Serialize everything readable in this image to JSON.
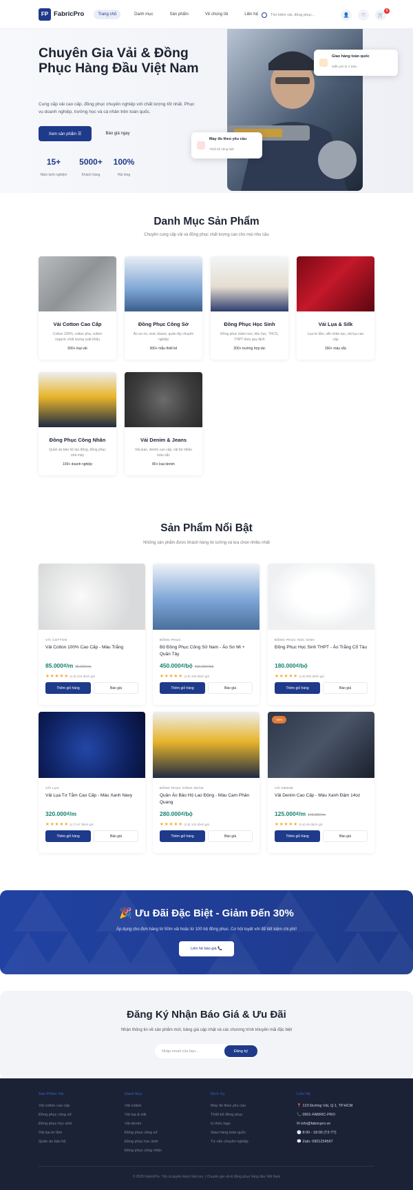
{
  "header": {
    "logo_mark": "FP",
    "logo_text": "FabricPro",
    "nav": [
      "Trang chủ",
      "Danh mục",
      "Sản phẩm",
      "Về chúng tôi",
      "Liên hệ"
    ],
    "search_placeholder": "Tìm kiếm vải, đồng phục...",
    "cart_count": "4"
  },
  "hero": {
    "title": "Chuyên Gia Vải & Đồng Phục Hàng Đầu Việt Nam",
    "desc": "Cung cấp vải cao cấp, đồng phục chuyên nghiệp với chất lượng tốt nhất. Phục vụ doanh nghiệp, trường học và cá nhân trên toàn quốc.",
    "cta_primary": "Xem sản phẩm ☰",
    "cta_secondary": "Báo giá ngay",
    "stats": [
      {
        "value": "15+",
        "label": "Năm kinh nghiệm"
      },
      {
        "value": "5000+",
        "label": "Khách hàng"
      },
      {
        "value": "100%",
        "label": "Hài lòng"
      }
    ],
    "float1_title": "Giao hàng toàn quốc",
    "float1_sub": "Miễn phí từ 2 triệu",
    "float2_title": "May đo theo yêu cầu",
    "float2_sub": "Thiết kế riêng biệt"
  },
  "categories": {
    "title": "Danh Mục Sản Phẩm",
    "subtitle": "Chuyên cung cấp vải và đồng phục chất lượng cao cho mọi nhu cầu",
    "items": [
      {
        "name": "Vải Cotton Cao Cấp",
        "desc": "Cotton 100%, cotton pha, cotton organic chất lượng xuất khẩu",
        "count": "500+ loại vải"
      },
      {
        "name": "Đồng Phục Công Sở",
        "desc": "Áo sơ mi, vest, blazer, quần tây chuyên nghiệp",
        "count": "300+ mẫu thiết kế"
      },
      {
        "name": "Đồng Phục Học Sinh",
        "desc": "Đồng phục mầm non, tiểu học, THCS, THPT theo quy định",
        "count": "200+ trường hợp tác"
      },
      {
        "name": "Vải Lụa & Silk",
        "desc": "Lụa tơ tằm, silk nhân tạo, vải lụa cao cấp",
        "count": "150+ màu sắc"
      },
      {
        "name": "Đồng Phục Công Nhân",
        "desc": "Quần áo bảo hộ lao động, đồng phục nhà máy",
        "count": "100+ doanh nghiệp"
      },
      {
        "name": "Vải Denim & Jeans",
        "desc": "Vải jean, denim cao cấp, vải bò nhiều màu sắc",
        "count": "80+ loại denim"
      }
    ]
  },
  "products": {
    "title": "Sản Phẩm Nổi Bật",
    "subtitle": "Những sản phẩm được khách hàng tin tưởng và lựa chọn nhiều nhất",
    "add_label": "Thêm giỏ hàng",
    "quote_label": "Báo giá",
    "items": [
      {
        "cat": "VẢI COTTON",
        "name": "Vải Cotton 100% Cao Cấp - Màu Trắng",
        "price": "85.000₫/m",
        "old": "95.000₫/m",
        "rating": "(4.9) 234 đánh giá"
      },
      {
        "cat": "ĐỒNG PHỤC",
        "name": "Bộ Đồng Phục Công Sở Nam - Áo Sơ Mi + Quần Tây",
        "price": "450.000₫/bộ",
        "old": "500.000₫/bộ",
        "rating": "(4.8) 156 đánh giá"
      },
      {
        "cat": "ĐỒNG PHỤC HỌC SINH",
        "name": "Đồng Phục Học Sinh THPT - Áo Trắng Cổ Tàu",
        "price": "180.000₫/bộ",
        "old": "",
        "rating": "(4.9) 892 đánh giá"
      },
      {
        "cat": "VẢI LỤA",
        "name": "Vải Lụa Tơ Tằm Cao Cấp - Màu Xanh Navy",
        "price": "320.000₫/m",
        "old": "",
        "rating": "(4.7) 67 đánh giá"
      },
      {
        "cat": "ĐỒNG PHỤC CÔNG NHÂN",
        "name": "Quần Áo Bảo Hộ Lao Động - Màu Cam Phản Quang",
        "price": "280.000₫/bộ",
        "old": "",
        "rating": "(4.8) 123 đánh giá"
      },
      {
        "cat": "VẢI DENIM",
        "name": "Vải Denim Cao Cấp - Màu Xanh Đậm 14oz",
        "price": "125.000₫/m",
        "old": "145.000₫/m",
        "rating": "(4.6) 89 đánh giá",
        "badge": "-15%"
      }
    ]
  },
  "promo": {
    "title": "🎉 Ưu Đãi Đặc Biệt - Giảm Đến 30%",
    "desc": "Áp dụng cho đơn hàng từ 50m vải hoặc từ 100 bộ đồng phục. Cơ hội tuyệt vời để tiết kiệm chi phí!",
    "button": "Liên hệ báo giá 📞"
  },
  "newsletter": {
    "title": "Đăng Ký Nhận Báo Giá & Ưu Đãi",
    "desc": "Nhận thông tin về sản phẩm mới, bảng giá cập nhật và các chương trình khuyến mãi đặc biệt",
    "placeholder": "Nhập email của bạn...",
    "button": "Đăng ký"
  },
  "footer": {
    "cols": [
      {
        "title": "Sản Phẩm Vải",
        "items": [
          "Vải cotton cao cấp",
          "Đồng phục công sở",
          "Đồng phục học sinh",
          "Vải lụa tơ tằm",
          "Quần áo bảo hộ"
        ]
      },
      {
        "title": "Danh Mục",
        "items": [
          "Vải cotton",
          "Vải lụa & silk",
          "Vải denim",
          "Đồng phục công sở",
          "Đồng phục học sinh",
          "Đồng phục công nhân"
        ]
      },
      {
        "title": "Dịch Vụ",
        "items": [
          "May đo theo yêu cầu",
          "Thiết kế đồng phục",
          "In thêu logo",
          "Giao hàng toàn quốc",
          "Tư vấn chuyên nghiệp"
        ]
      },
      {
        "title": "Liên Hệ",
        "items": [
          "📍 123 Đường Vải, Q.1, TP.HCM",
          "📞 0901-FABRIC-PRO",
          "✉ info@fabricpro.vn",
          "🕐 8:00 - 18:00 (T2-T7)",
          "💬 Zalo: 0901234567"
        ]
      }
    ],
    "copyright": "© 2025 FabricPro. Tất cả quyền được bảo lưu. | Chuyên gia vải & đồng phục hàng đầu Việt Nam"
  },
  "colors": {
    "brand": "#1e3a8a",
    "price": "#14806e",
    "footer_bg": "#1b2235",
    "star": "#f5a623"
  }
}
